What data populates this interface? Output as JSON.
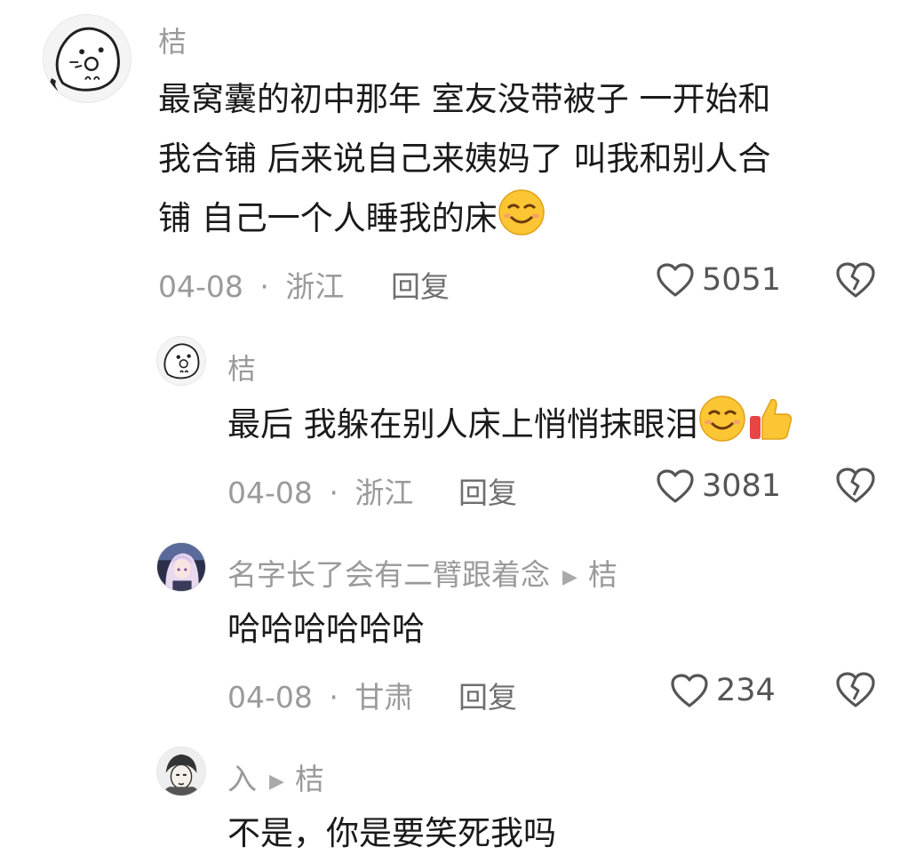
{
  "comments": [
    {
      "username": "桔",
      "text_lines": [
        "最窝囊的初中那年  室友没带被子  一开始和",
        "我合铺  后来说自己来姨妈了  叫我和别人合",
        "铺  自己一个人睡我的床"
      ],
      "trailing_emojis": [
        "smiling-face"
      ],
      "date": "04-08",
      "location": "浙江",
      "reply_label": "回复",
      "likes": "5051"
    },
    {
      "username": "桔",
      "text_lines": [
        "最后  我躲在别人床上悄悄抹眼泪"
      ],
      "trailing_emojis": [
        "smiling-face",
        "thumbs-up"
      ],
      "date": "04-08",
      "location": "浙江",
      "reply_label": "回复",
      "likes": "3081"
    },
    {
      "username": "名字长了会有二臂跟着念",
      "reply_to": "桔",
      "text_lines": [
        "哈哈哈哈哈哈"
      ],
      "date": "04-08",
      "location": "甘肃",
      "reply_label": "回复",
      "likes": "234"
    },
    {
      "username": "入",
      "reply_to": "桔",
      "text_lines": [
        "不是，你是要笑死我吗"
      ]
    }
  ],
  "separator": "·",
  "icons": {
    "like": "heart-outline-icon",
    "dislike": "broken-heart-icon",
    "reply_arrow": "play-triangle-icon"
  }
}
